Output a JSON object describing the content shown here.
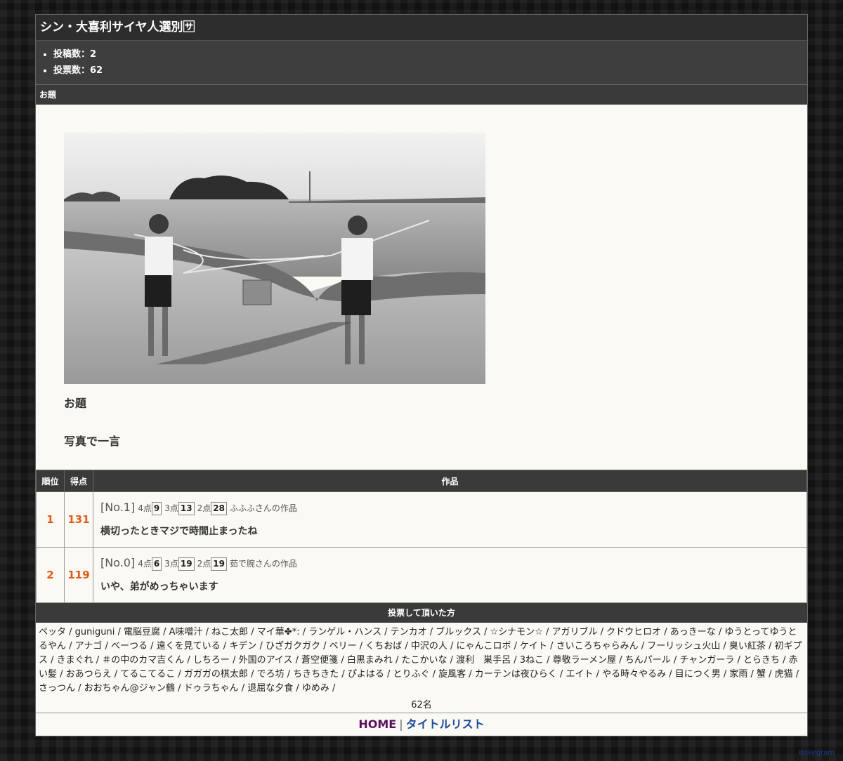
{
  "title": "シン・大喜利サイヤ人選別🈂",
  "stats": {
    "posts": "投稿数：2",
    "votes": "投票数：62"
  },
  "odai_section": {
    "heading": "お題",
    "label": "お題",
    "text": "写真で一言"
  },
  "ranking": {
    "headers": {
      "rank": "順位",
      "score": "得点",
      "work": "作品"
    },
    "rows": [
      {
        "rank": "1",
        "score": "131",
        "no": "[No.1]",
        "p4_label": "4点",
        "p4": "9",
        "p3_label": "3点",
        "p3": "13",
        "p2_label": "2点",
        "p2": "28",
        "author": "ふふふさんの作品",
        "text": "横切ったときマジで時間止まったね"
      },
      {
        "rank": "2",
        "score": "119",
        "no": "[No.0]",
        "p4_label": "4点",
        "p4": "6",
        "p3_label": "3点",
        "p3": "19",
        "p2_label": "2点",
        "p2": "19",
        "author": "茹で腕さんの作品",
        "text": "いや、弟がめっちゃいます"
      }
    ]
  },
  "voters": {
    "heading": "投票して頂いた方",
    "list": "ペッタ / guniguni / 電脳豆腐 / A味噌汁 / ねこ太郎 / マイ華✤*: / ランゲル・ハンス / テンカオ / ブルックス / ☆シナモン☆ / アガリブル / クドウヒロオ / あっきーな / ゆうとってゆうとるやん / アナゴ / べーつる / 遠くを見ている / キデン / ひざガクガク / ベリー / くちおば / 中沢の人 / にゃんこロボ / ケイト / さいころちゃらみん / フーリッシュ火山 / 臭い紅茶 / 初ギプス / きまぐれ / ＃の中のカマ吉くん / しちろー / 外国のアイス / 蒼空便箋 / 白黒まみれ / たこかいな / 渡利　巣手呂 / 3ねこ / 尊敬ラーメン屋 / ちんパール / チャンガーラ / とらきち / 赤い髪 / おあつらえ / てるこてるこ / ガガガの棋太郎 / でろ坊 / ちきちきた / ぴよはる / とりふぐ / 旋風客 / カーテンは夜ひらく / エイト / やる時々やるみ / 目につく男 / 家雨 / 蟹 / 虎猫 / さっつん / おおちゃん@ジャン鶴 / ドゥラちゃん / 退屈な夕食 / ゆめみ /",
    "count": "62名"
  },
  "footer": {
    "home": "HOME",
    "separator": "|",
    "titlelist": "タイトルリスト"
  },
  "brand": "Bokegram"
}
